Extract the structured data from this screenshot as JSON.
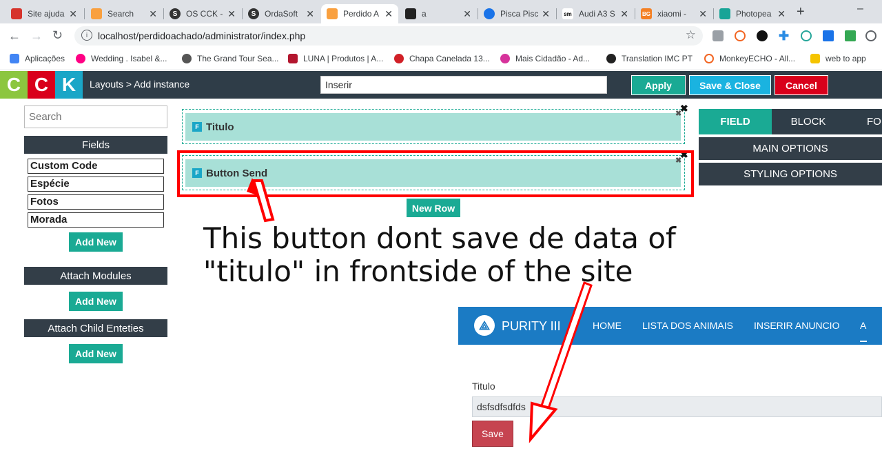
{
  "browser": {
    "tabs": [
      {
        "title": "Site ajuda",
        "color": "#d6342c"
      },
      {
        "title": "Search",
        "color": "#f9a03f"
      },
      {
        "title": "OS CCK -",
        "color": "#333333"
      },
      {
        "title": "OrdaSoft",
        "color": "#333333"
      },
      {
        "title": "Perdido A",
        "color": "#f9a03f"
      },
      {
        "title": "a",
        "color": "#222222"
      },
      {
        "title": "Pisca Pisc",
        "color": "#1a73e8"
      },
      {
        "title": "Audi A3 S",
        "color": "#ffffff"
      },
      {
        "title": "xiaomi - ",
        "color": "#f48024"
      },
      {
        "title": "Photopea",
        "color": "#18a497"
      }
    ],
    "new_tab": "+",
    "minimize": "–",
    "url": "localhost/perdidoachado/administrator/index.php",
    "bookmarks": [
      {
        "label": "Aplicações",
        "color": "#4285f4"
      },
      {
        "label": "Wedding . Isabel &...",
        "color": "#ff0084"
      },
      {
        "label": "The Grand Tour Sea...",
        "color": "#555555"
      },
      {
        "label": "LUNA | Produtos | A...",
        "color": "#b3162e"
      },
      {
        "label": "Chapa Canelada 13...",
        "color": "#d12027"
      },
      {
        "label": "Mais Cidadão - Ad...",
        "color": "#d6339b"
      },
      {
        "label": "Translation  IMC PT",
        "color": "#222222"
      },
      {
        "label": "MonkeyECHO - All...",
        "color": "#f26522"
      },
      {
        "label": "web to app",
        "color": "#222222"
      }
    ]
  },
  "cck": {
    "logo": [
      "C",
      "C",
      "K"
    ],
    "breadcrumb": "Layouts > Add instance",
    "title_input": "Inserir",
    "apply": "Apply",
    "save_close": "Save & Close",
    "cancel": "Cancel"
  },
  "sidebar": {
    "search_placeholder": "Search",
    "fields_header": "Fields",
    "fields": [
      "Custom Code",
      "Espécie",
      "Fotos",
      "Morada"
    ],
    "add_new": "Add New",
    "attach_modules": "Attach Modules",
    "attach_child": "Attach Child Enteties"
  },
  "canvas": {
    "rows": [
      {
        "badge": "F",
        "label": "Titulo"
      },
      {
        "badge": "F",
        "label": "Button Send"
      }
    ],
    "new_row": "New Row",
    "close": "✖"
  },
  "right_panel": {
    "tabs": [
      "FIELD",
      "BLOCK",
      "FO"
    ],
    "main_options": "MAIN OPTIONS",
    "styling_options": "STYLING OPTIONS"
  },
  "annotation": {
    "line1": "This button dont save de data of",
    "line2": "\"titulo\" in frontside of the site"
  },
  "frontend": {
    "brand": "PURITY III",
    "nav": [
      "HOME",
      "LISTA DOS ANIMAIS",
      "INSERIR ANUNCIO",
      "A"
    ],
    "field_label": "Titulo",
    "field_value": "dsfsdfsdfds",
    "save": "Save"
  },
  "colors": {
    "accent": "#1aaa94",
    "cancel": "#d9001b",
    "save_close": "#1ab3e0",
    "annotation_red": "#ff0000",
    "purity_blue": "#1b7bc4"
  }
}
